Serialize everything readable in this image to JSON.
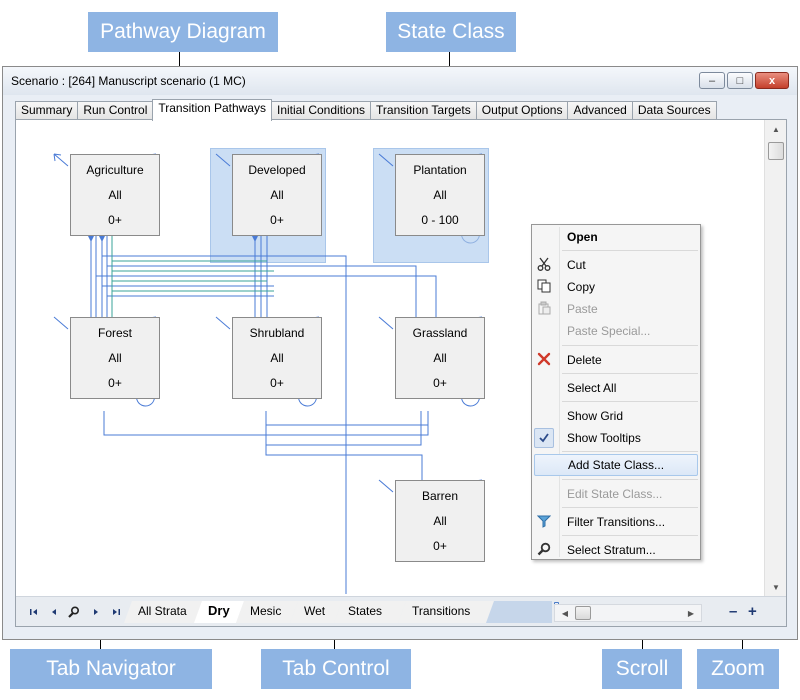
{
  "callouts": {
    "pathway_diagram": "Pathway Diagram",
    "state_class": "State Class",
    "tab_navigator": "Tab Navigator",
    "tab_control": "Tab Control",
    "scroll": "Scroll",
    "zoom": "Zoom"
  },
  "window": {
    "title": "Scenario : [264] Manuscript scenario (1 MC)",
    "minimize_glyph": "–",
    "maximize_glyph": "□",
    "close_glyph": "x"
  },
  "tabs": [
    "Summary",
    "Run Control",
    "Transition Pathways",
    "Initial Conditions",
    "Transition Targets",
    "Output Options",
    "Advanced",
    "Data Sources"
  ],
  "active_tab": "Transition Pathways",
  "states": {
    "agriculture": {
      "name": "Agriculture",
      "stratum": "All",
      "age": "0+"
    },
    "developed": {
      "name": "Developed",
      "stratum": "All",
      "age": "0+"
    },
    "plantation": {
      "name": "Plantation",
      "stratum": "All",
      "age": "0 - 100"
    },
    "forest": {
      "name": "Forest",
      "stratum": "All",
      "age": "0+"
    },
    "shrubland": {
      "name": "Shrubland",
      "stratum": "All",
      "age": "0+"
    },
    "grassland": {
      "name": "Grassland",
      "stratum": "All",
      "age": "0+"
    },
    "barren": {
      "name": "Barren",
      "stratum": "All",
      "age": "0+"
    }
  },
  "context_menu": {
    "open": "Open",
    "cut": "Cut",
    "copy": "Copy",
    "paste": "Paste",
    "paste_special": "Paste Special...",
    "delete": "Delete",
    "select_all": "Select All",
    "show_grid": "Show Grid",
    "show_tooltips": "Show Tooltips",
    "add_state_class": "Add State Class...",
    "edit_state_class": "Edit State Class...",
    "filter_transitions": "Filter Transitions...",
    "select_stratum": "Select Stratum..."
  },
  "bottom_tabs": {
    "all_strata": "All Strata",
    "dry": "Dry",
    "mesic": "Mesic",
    "wet": "Wet",
    "states": "States",
    "transitions": "Transitions"
  },
  "zoom": {
    "out": "–",
    "in": "+"
  },
  "colors": {
    "callout": "#8eb4e3",
    "pathway_blue": "#4a7bd6",
    "pathway_teal": "#3aa39a",
    "highlight": "#a0c3eb"
  }
}
